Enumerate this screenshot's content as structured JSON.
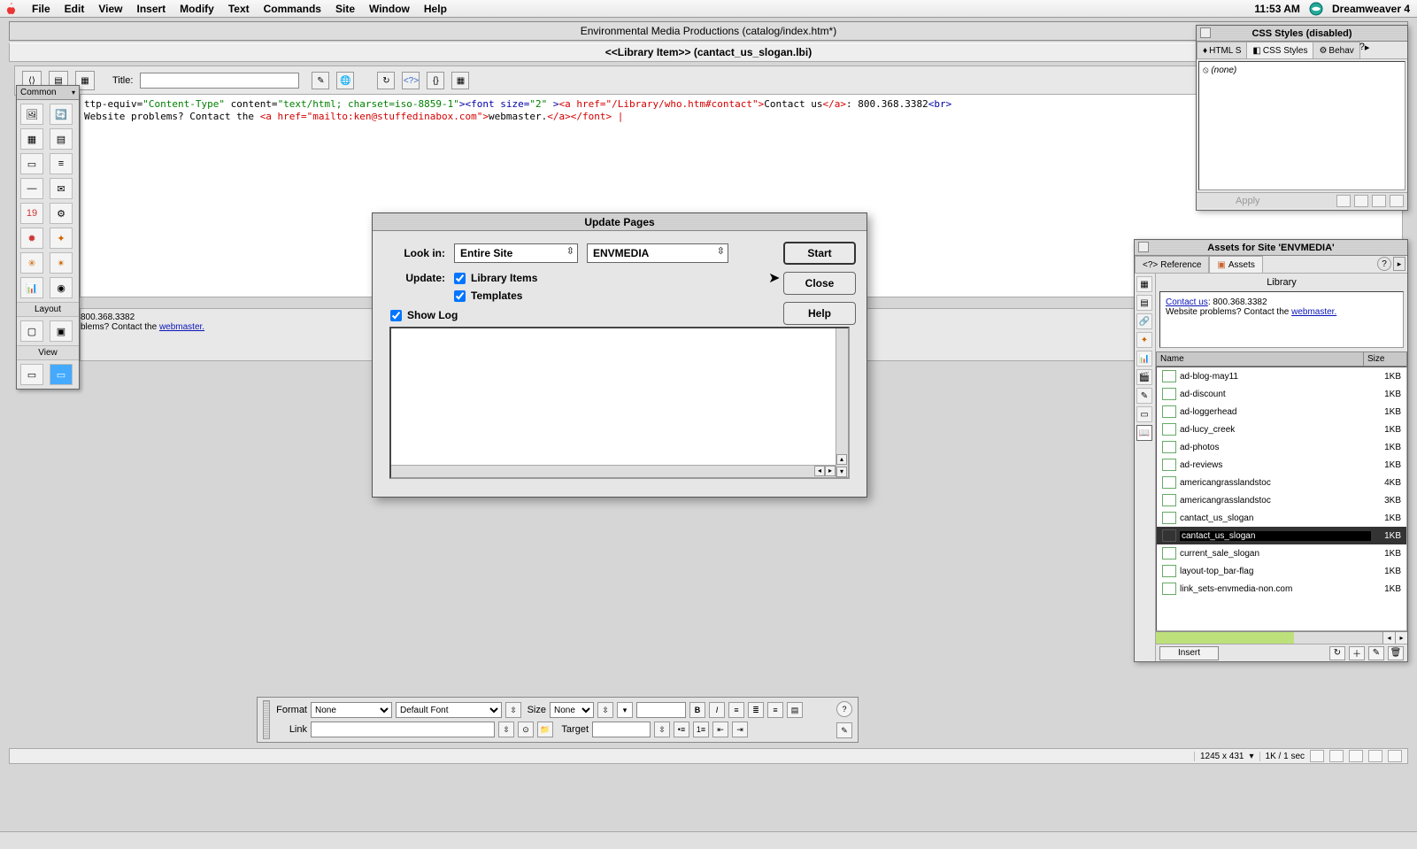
{
  "menubar": {
    "items": [
      "File",
      "Edit",
      "View",
      "Insert",
      "Modify",
      "Text",
      "Commands",
      "Site",
      "Window",
      "Help"
    ],
    "clock": "11:53 AM",
    "app_name": "Dreamweaver 4"
  },
  "document": {
    "title": "Environmental Media Productions (catalog/index.htm*)",
    "subtitle": "<<Library Item>>  (cantact_us_slogan.lbi)"
  },
  "toolbar": {
    "title_label": "Title:",
    "title_value": ""
  },
  "code": {
    "line1_prefix": "ttp-equiv=",
    "line1_ct": "\"Content-Type\"",
    "line1_content": " content=",
    "line1_charset": "\"text/html; charset=iso-8859-1\"",
    "line1_fontsize_open": "><font size=",
    "line1_fontsize_val": "\"2\"",
    "line1_gt": " >",
    "line1_a_open": "<a href=",
    "line1_href1": "\"/Library/who.htm#contact\"",
    "line1_gt2": ">",
    "line1_text1": "Contact us",
    "line1_a_close": "</a>",
    "line1_phone": ": 800.368.3382",
    "line1_br": "<br>",
    "line2_indent": "        ",
    "line2_text": "Website problems? Contact the ",
    "line2_a_open": "<a href=",
    "line2_href2": "\"mailto:ken@stuffedinabox.com\"",
    "line2_gt": ">",
    "line2_text2": "webmaster.",
    "line2_a_close": "</a></font> |"
  },
  "preview": {
    "phone": "800.368.3382",
    "trouble": "blems? Contact the ",
    "webmaster": "webmaster."
  },
  "common_palette": {
    "title": "Common",
    "section_layout": "Layout",
    "section_view": "View"
  },
  "modal": {
    "title": "Update Pages",
    "lookin_label": "Look in:",
    "lookin_option": "Entire Site",
    "site_option": "ENVMEDIA",
    "update_label": "Update:",
    "check_library": "Library Items",
    "check_templates": "Templates",
    "show_log": "Show Log",
    "btn_start": "Start",
    "btn_close": "Close",
    "btn_help": "Help"
  },
  "css_panel": {
    "title": "CSS Styles (disabled)",
    "tab_html": "HTML S",
    "tab_css": "CSS Styles",
    "tab_behav": "Behav",
    "item_none": "(none)",
    "apply_label": "Apply"
  },
  "assets_panel": {
    "title": "Assets for Site 'ENVMEDIA'",
    "tab_reference": "Reference",
    "tab_assets": "Assets",
    "category": "Library",
    "preview_contact": "Contact us",
    "preview_phone": ": 800.368.3382",
    "preview_trouble": "Website problems? Contact the ",
    "preview_webmaster": "webmaster.",
    "col_name": "Name",
    "col_size": "Size",
    "items": [
      {
        "name": "ad-blog-may11",
        "size": "1KB"
      },
      {
        "name": "ad-discount",
        "size": "1KB"
      },
      {
        "name": "ad-loggerhead",
        "size": "1KB"
      },
      {
        "name": "ad-lucy_creek",
        "size": "1KB"
      },
      {
        "name": "ad-photos",
        "size": "1KB"
      },
      {
        "name": "ad-reviews",
        "size": "1KB"
      },
      {
        "name": "americangrasslandstoc",
        "size": "4KB"
      },
      {
        "name": "americangrasslandstoc",
        "size": "3KB"
      },
      {
        "name": "cantact_us_slogan",
        "size": "1KB"
      },
      {
        "name": "cantact_us_slogan",
        "size": "1KB",
        "selected": true
      },
      {
        "name": "current_sale_slogan",
        "size": "1KB"
      },
      {
        "name": "layout-top_bar-flag",
        "size": "1KB"
      },
      {
        "name": "link_sets-envmedia-non.com",
        "size": "1KB"
      }
    ],
    "btn_insert": "Insert"
  },
  "propbar": {
    "format_label": "Format",
    "format_value": "None",
    "font_value": "Default Font",
    "size_label": "Size",
    "size_value": "None",
    "link_label": "Link",
    "target_label": "Target"
  },
  "statusbar": {
    "dims": "1245 x 431",
    "size_time": "1K / 1 sec"
  }
}
